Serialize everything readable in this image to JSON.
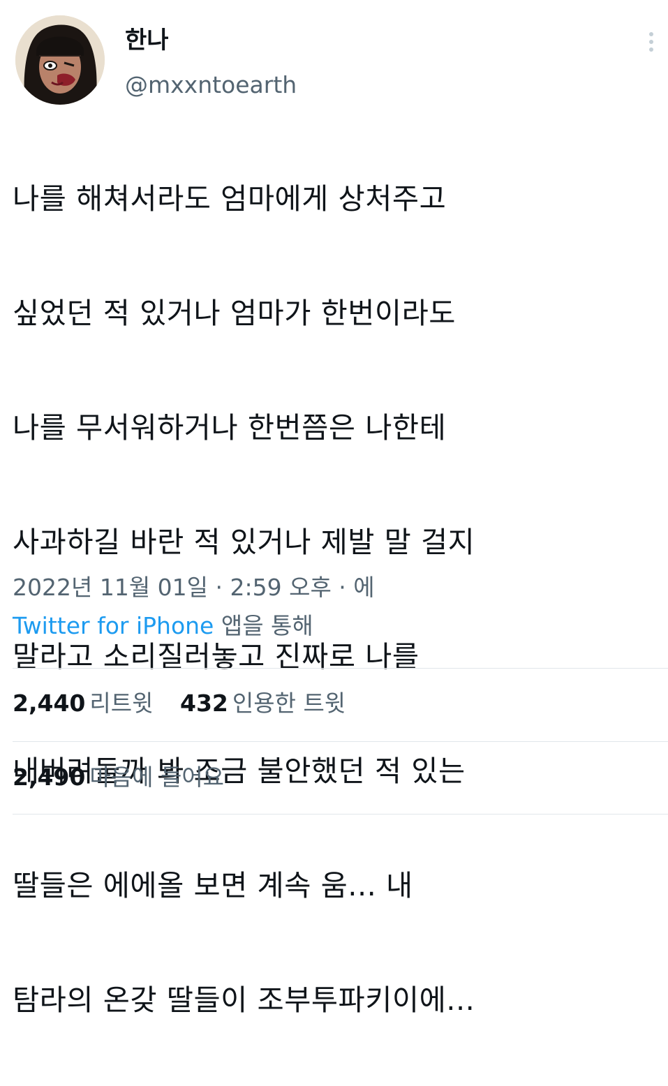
{
  "author": {
    "display_name": "한나",
    "handle": "@mxxntoearth"
  },
  "tweet": {
    "lines": [
      "나를 해쳐서라도 엄마에게 상처주고",
      "싶었던 적 있거나 엄마가 한번이라도",
      "나를 무서워하거나 한번쯤은 나한테",
      "사과하길 바란 적 있거나 제발 말 걸지",
      "말라고 소리질러놓고 진짜로 나를",
      "내버려둘까 봐 조금 불안했던 적 있는",
      "딸들은 에에올 보면 계속 움... 내",
      "탐라의 온갖 딸들이 조부투파키이에..."
    ]
  },
  "meta": {
    "date_time": "2022년 11월 01일 · 2:59 오후 · 에",
    "source_link": "Twitter for iPhone",
    "source_suffix": " 앱을 통해"
  },
  "stats": {
    "retweets_count": "2,440",
    "retweets_label": "리트윗",
    "quotes_count": "432",
    "quotes_label": "인용한 트윗",
    "likes_count": "2,490",
    "likes_label": "마음에 들어요"
  },
  "colors": {
    "text_primary": "#0f1419",
    "text_secondary": "#536471",
    "link": "#1d9bf0",
    "divider": "#e1e6ea"
  },
  "icons": {
    "more": "vertical-dots-icon",
    "avatar": "profile-photo"
  }
}
